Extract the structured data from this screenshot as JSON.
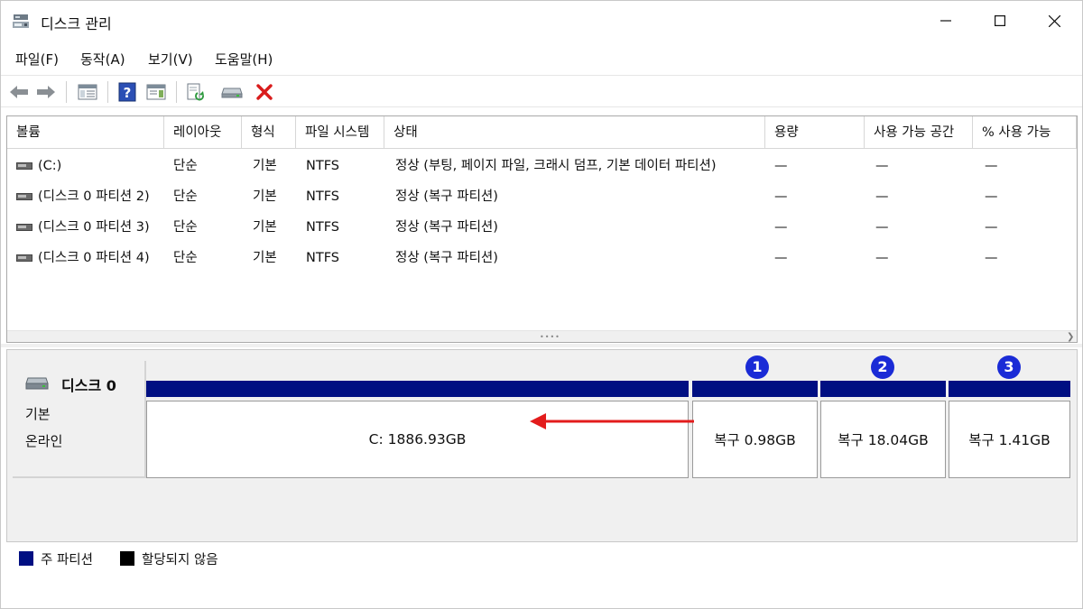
{
  "window": {
    "title": "디스크 관리"
  },
  "menu": [
    {
      "label": "파일(F)"
    },
    {
      "label": "동작(A)"
    },
    {
      "label": "보기(V)"
    },
    {
      "label": "도움말(H)"
    }
  ],
  "volume_list": {
    "columns": [
      "볼륨",
      "레이아웃",
      "형식",
      "파일 시스템",
      "상태",
      "용량",
      "사용 가능 공간",
      "% 사용 가능"
    ],
    "rows": [
      {
        "volume": "(C:)",
        "layout": "단순",
        "type": "기본",
        "fs": "NTFS",
        "status": "정상 (부팅, 페이지 파일, 크래시 덤프, 기본 데이터 파티션)",
        "capacity": "—",
        "free": "—",
        "pct": "—"
      },
      {
        "volume": "(디스크 0 파티션 2)",
        "layout": "단순",
        "type": "기본",
        "fs": "NTFS",
        "status": "정상 (복구 파티션)",
        "capacity": "—",
        "free": "—",
        "pct": "—"
      },
      {
        "volume": "(디스크 0 파티션 3)",
        "layout": "단순",
        "type": "기본",
        "fs": "NTFS",
        "status": "정상 (복구 파티션)",
        "capacity": "—",
        "free": "—",
        "pct": "—"
      },
      {
        "volume": "(디스크 0 파티션 4)",
        "layout": "단순",
        "type": "기본",
        "fs": "NTFS",
        "status": "정상 (복구 파티션)",
        "capacity": "—",
        "free": "—",
        "pct": "—"
      }
    ]
  },
  "disk": {
    "name": "디스크 0",
    "type": "기본",
    "status": "온라인",
    "partitions": [
      {
        "label": "C:  1886.93GB"
      },
      {
        "label": "복구 0.98GB",
        "badge": "1"
      },
      {
        "label": "복구 18.04GB",
        "badge": "2"
      },
      {
        "label": "복구 1.41GB",
        "badge": "3"
      }
    ]
  },
  "legend": [
    {
      "label": "주 파티션",
      "color": "#000f82"
    },
    {
      "label": "할당되지 않음",
      "color": "#000000"
    }
  ],
  "colors": {
    "primary_partition": "#000f82",
    "badge": "#1a2bd6",
    "arrow": "#e31c1c"
  }
}
